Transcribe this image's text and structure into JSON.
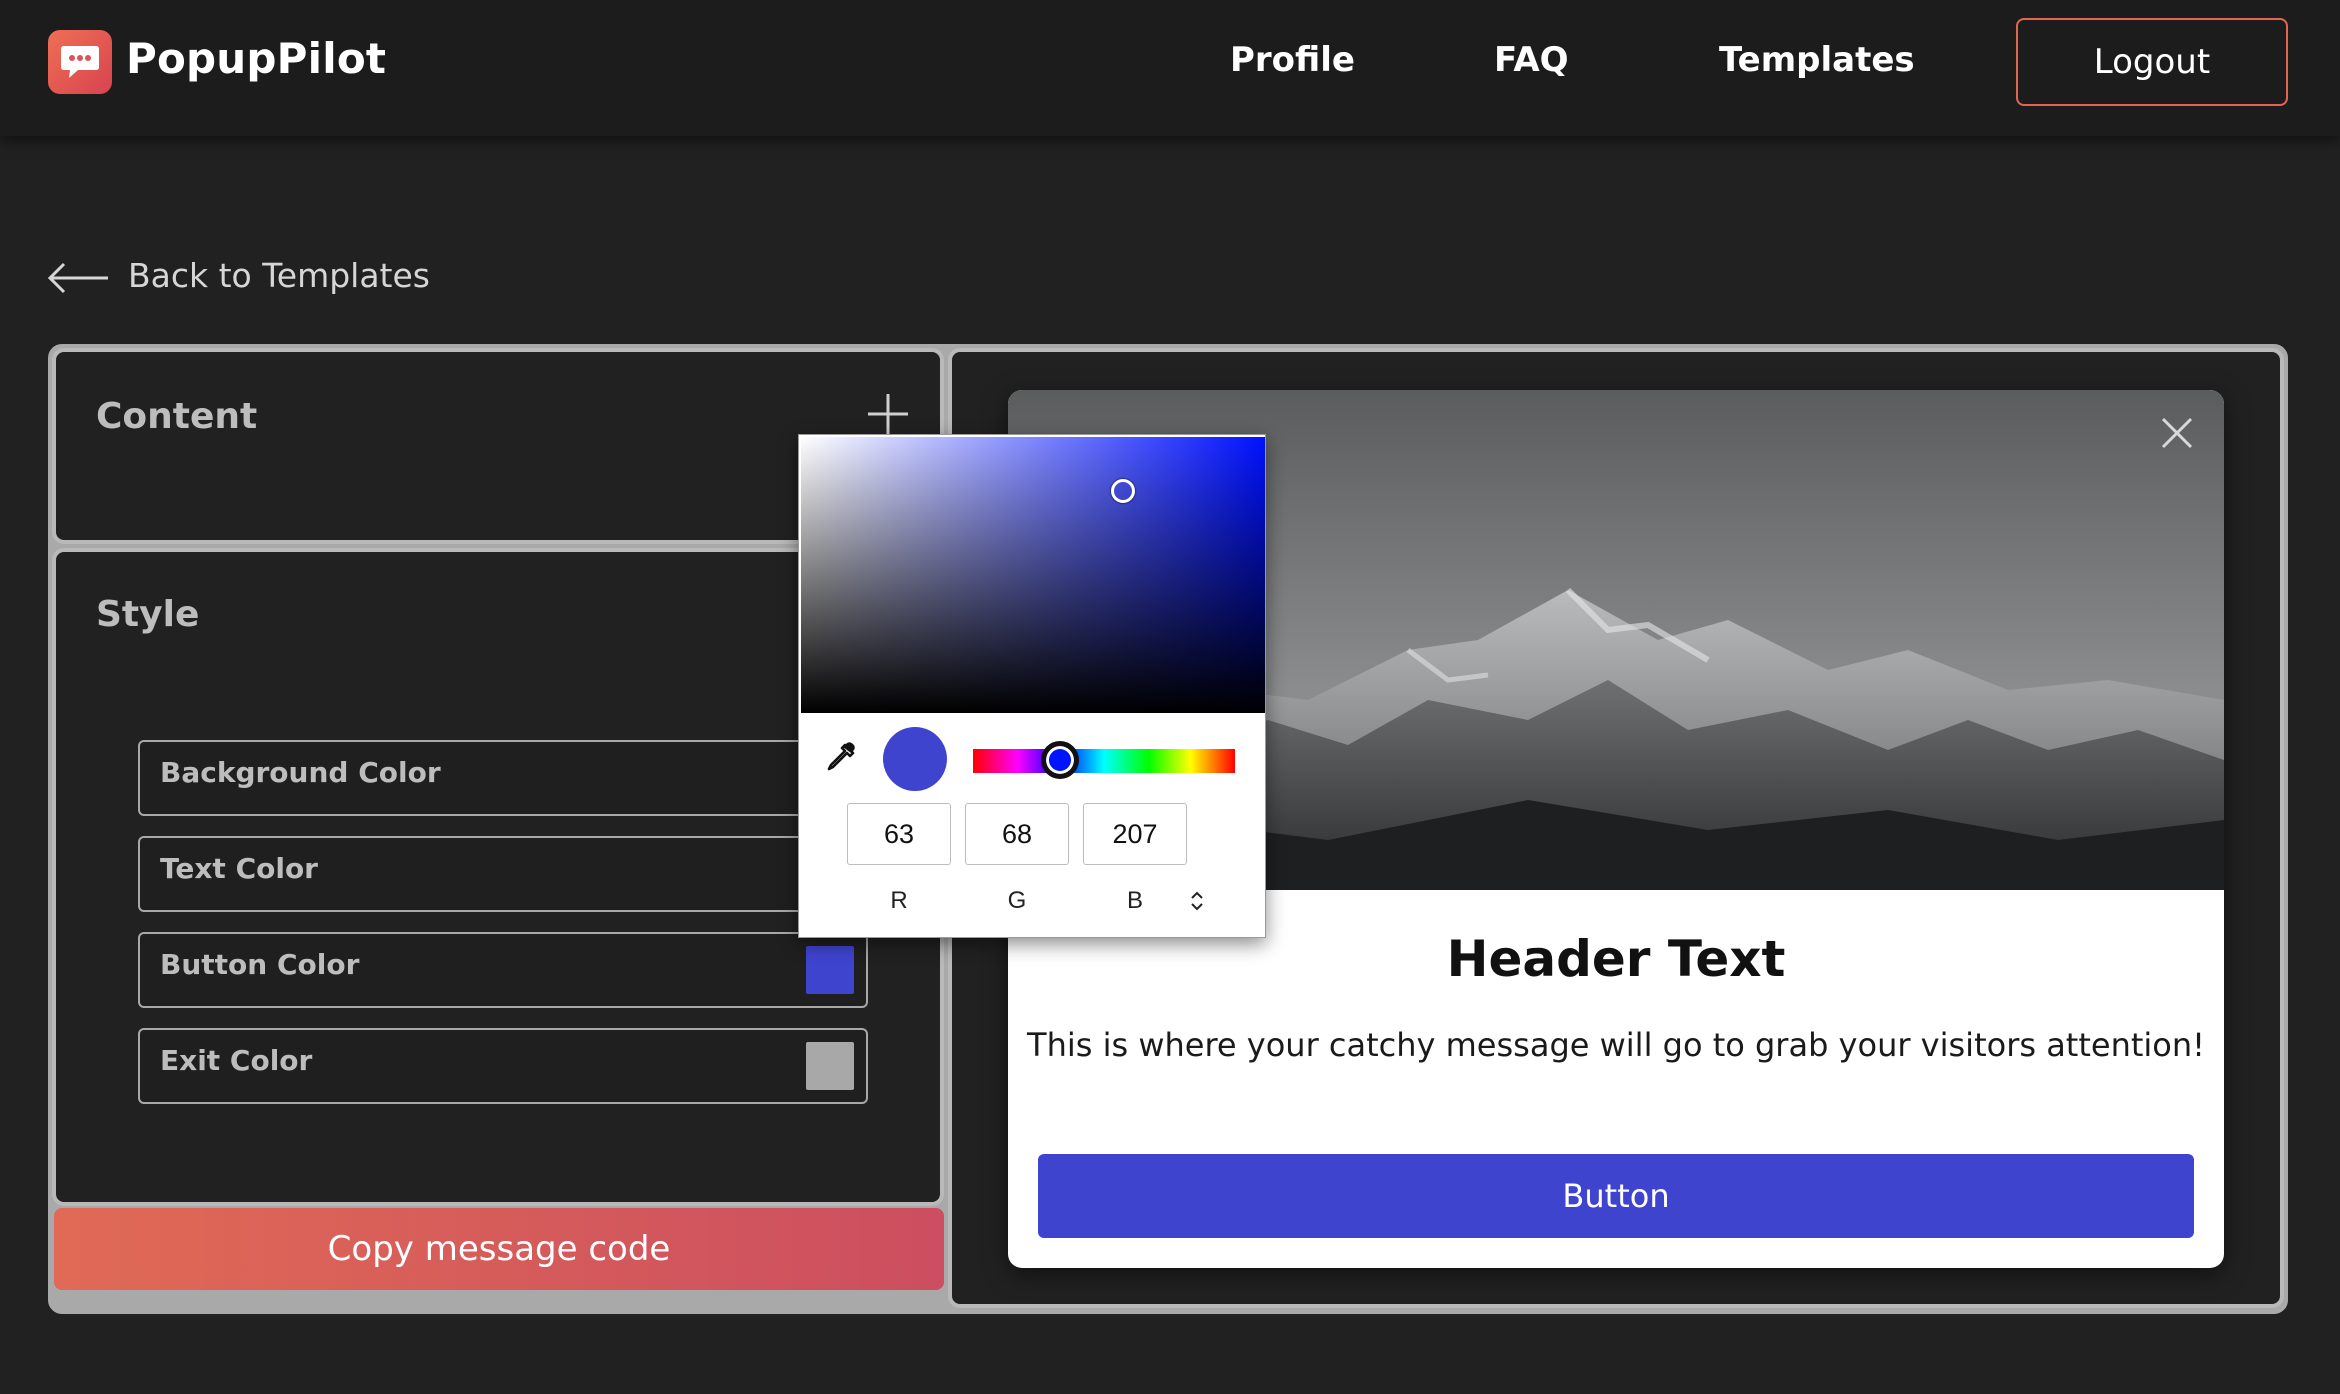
{
  "app": {
    "name": "PopupPilot"
  },
  "nav": {
    "profile": "Profile",
    "faq": "FAQ",
    "templates": "Templates",
    "logout": "Logout"
  },
  "back_link": {
    "label": "Back to Templates"
  },
  "editor": {
    "content_title": "Content",
    "style_title": "Style",
    "fields": {
      "background": "Background Color",
      "text": "Text Color",
      "button": "Button Color",
      "exit": "Exit Color"
    },
    "copy_button": "Copy message code"
  },
  "colors": {
    "button_color": "#3f44cf",
    "exit_color": "#a8a8a8",
    "accent": "#e2664f"
  },
  "color_picker": {
    "r": "63",
    "g": "68",
    "b": "207",
    "r_label": "R",
    "g_label": "G",
    "b_label": "B"
  },
  "popup": {
    "header": "Header Text",
    "message": "This is where your catchy message will go to grab your visitors attention!",
    "button": "Button"
  }
}
